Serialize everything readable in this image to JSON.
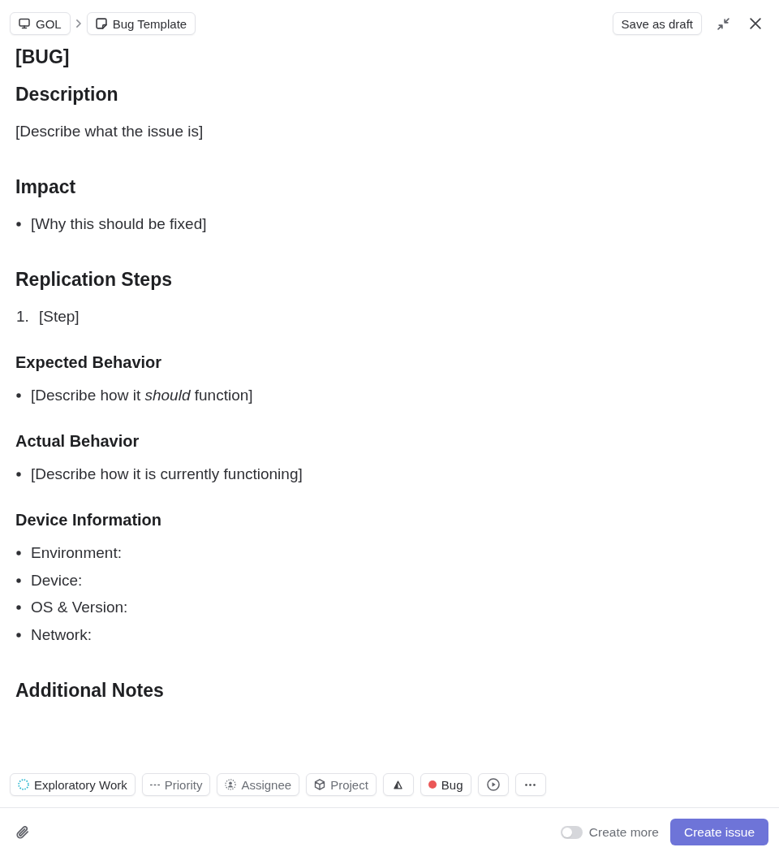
{
  "header": {
    "breadcrumbs": [
      {
        "kind": "team",
        "label": "GOL"
      },
      {
        "kind": "template",
        "label": "Bug Template"
      }
    ],
    "save_draft": "Save as draft"
  },
  "editor": {
    "title": "[BUG]",
    "blocks": [
      {
        "kind": "h2",
        "text": "Description"
      },
      {
        "kind": "paragraph",
        "text": "[Describe what the issue is]"
      },
      {
        "kind": "h2",
        "text": "Impact"
      },
      {
        "kind": "bullet",
        "text": "[Why this should be fixed]"
      },
      {
        "kind": "h2",
        "text": "Replication Steps"
      },
      {
        "kind": "numbered",
        "number": "1.",
        "text": "[Step]"
      },
      {
        "kind": "h3",
        "text": "Expected Behavior"
      },
      {
        "kind": "bullet",
        "text": "[Describe how it *should* function]"
      },
      {
        "kind": "h3",
        "text": "Actual Behavior"
      },
      {
        "kind": "bullet",
        "text": "[Describe how it is currently functioning]"
      },
      {
        "kind": "h3",
        "text": "Device Information"
      },
      {
        "kind": "bullet",
        "text": "Environment:"
      },
      {
        "kind": "bullet",
        "text": "Device:"
      },
      {
        "kind": "bullet",
        "text": "OS & Version:"
      },
      {
        "kind": "bullet",
        "text": "Network:"
      },
      {
        "kind": "h2",
        "text": "Additional Notes"
      }
    ]
  },
  "properties": [
    {
      "kind": "status",
      "label": "Exploratory Work",
      "empty": false
    },
    {
      "kind": "priority",
      "label": "Priority",
      "empty": true
    },
    {
      "kind": "assignee",
      "label": "Assignee",
      "empty": true
    },
    {
      "kind": "project",
      "label": "Project",
      "empty": true
    },
    {
      "kind": "estimate"
    },
    {
      "kind": "label",
      "label": "Bug",
      "color": "#eb5757",
      "empty": false
    },
    {
      "kind": "cycle"
    },
    {
      "kind": "more"
    }
  ],
  "footer": {
    "create_more": {
      "label": "Create more",
      "on": false
    },
    "submit": "Create issue"
  }
}
